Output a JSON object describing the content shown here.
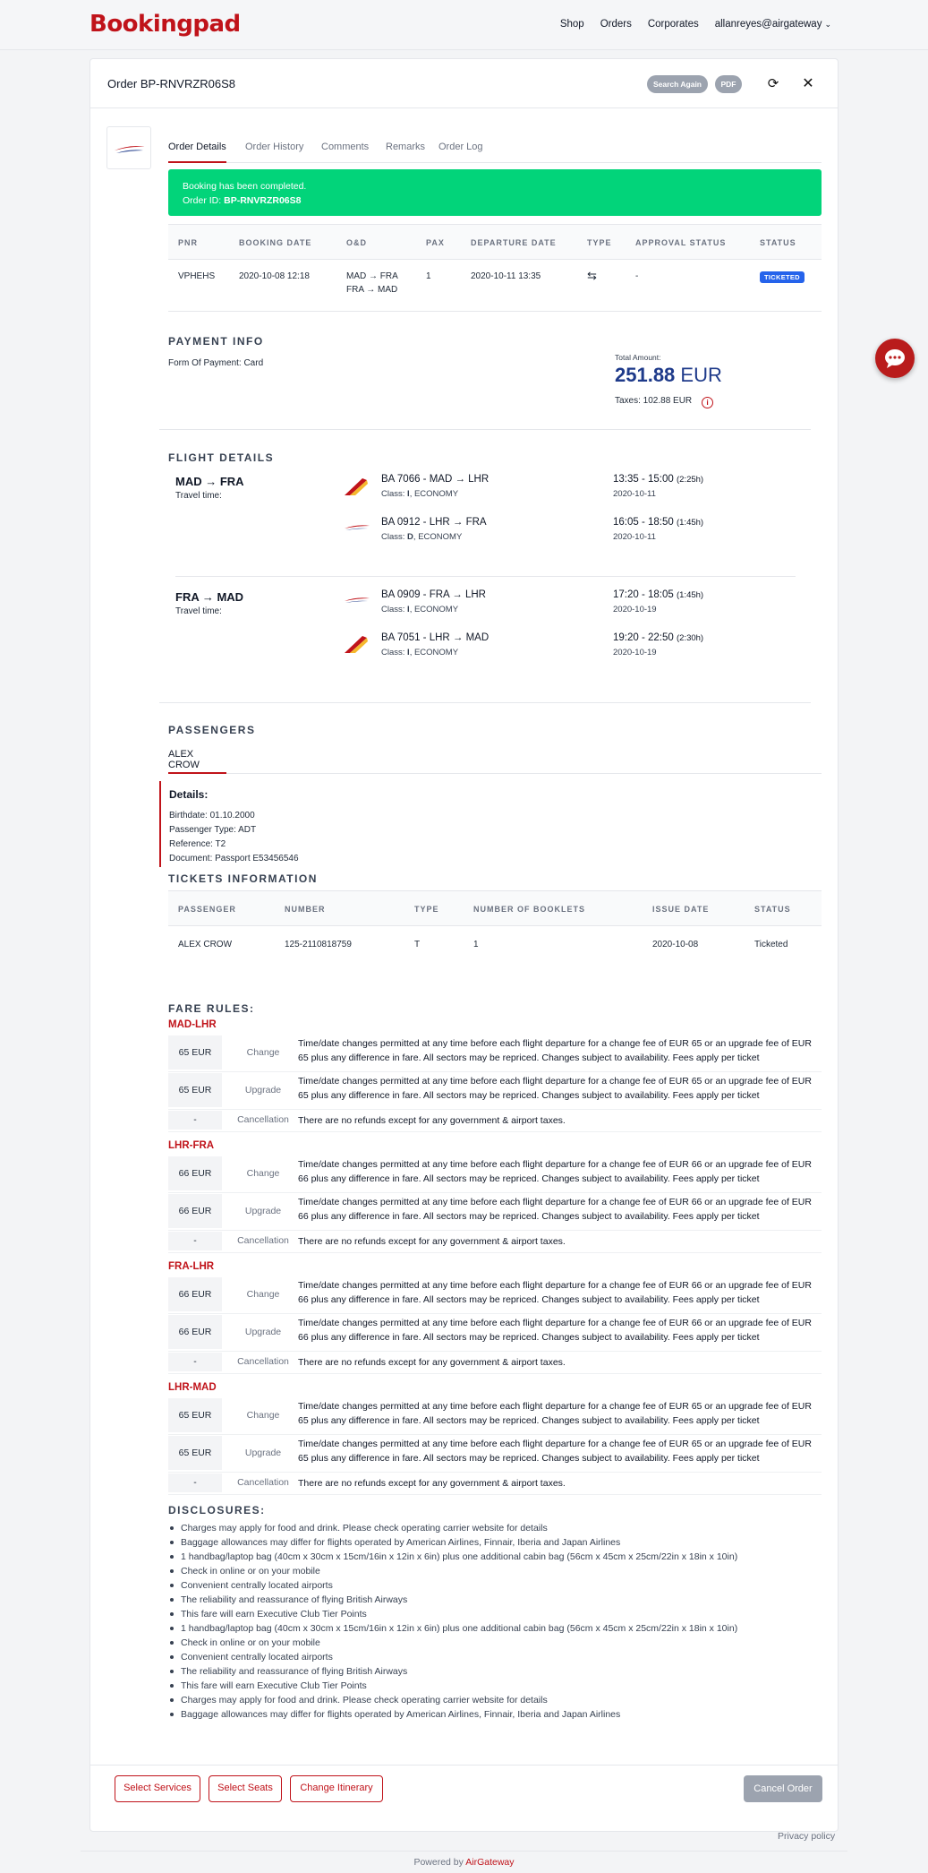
{
  "brand": {
    "name": "Bookingpad"
  },
  "nav": {
    "shop": "Shop",
    "orders": "Orders",
    "corporates": "Corporates",
    "user": "allanreyes@airgateway"
  },
  "order": {
    "title": "Order BP-RNVRZR06S8",
    "search_again": "Search Again",
    "pdf": "PDF"
  },
  "tabs": [
    "Order Details",
    "Order History",
    "Comments",
    "Remarks",
    "Order Log"
  ],
  "alert": {
    "line1": "Booking has been completed.",
    "line2_label": "Order ID:",
    "line2_value": "BP-RNVRZR06S8"
  },
  "booking_table": {
    "headers": [
      "PNR",
      "BOOKING DATE",
      "O&D",
      "PAX",
      "DEPARTURE DATE",
      "TYPE",
      "APPROVAL STATUS",
      "STATUS"
    ],
    "row": {
      "pnr": "VPHEHS",
      "booking_date": "2020-10-08 12:18",
      "od1": "MAD → FRA",
      "od2": "FRA → MAD",
      "pax": "1",
      "departure": "2020-10-11 13:35",
      "approval": "-",
      "status": "TICKETED"
    }
  },
  "payment": {
    "title": "PAYMENT INFO",
    "form": "Form Of Payment: Card",
    "total_label": "Total Amount:",
    "total_value": "251.88",
    "currency": "EUR",
    "taxes": "Taxes: 102.88 EUR"
  },
  "flights": {
    "title": "FLIGHT DETAILS",
    "travel_time_label": "Travel time:",
    "legs": [
      {
        "route": "MAD → FRA",
        "segments": [
          {
            "title": "BA 7066 - MAD → LHR",
            "class_label": "Class:",
            "class_code": "I",
            "cabin": ", ECONOMY",
            "time": "13:35 - 15:00",
            "duration": "(2:25h)",
            "date": "2020-10-11"
          },
          {
            "title": "BA 0912 - LHR → FRA",
            "class_label": "Class:",
            "class_code": "D",
            "cabin": ", ECONOMY",
            "time": "16:05 - 18:50",
            "duration": "(1:45h)",
            "date": "2020-10-11"
          }
        ]
      },
      {
        "route": "FRA → MAD",
        "segments": [
          {
            "title": "BA 0909 - FRA → LHR",
            "class_label": "Class:",
            "class_code": "I",
            "cabin": ", ECONOMY",
            "time": "17:20 - 18:05",
            "duration": "(1:45h)",
            "date": "2020-10-19"
          },
          {
            "title": "BA 7051 - LHR → MAD",
            "class_label": "Class:",
            "class_code": "I",
            "cabin": ", ECONOMY",
            "time": "19:20 - 22:50",
            "duration": "(2:30h)",
            "date": "2020-10-19"
          }
        ]
      }
    ]
  },
  "passengers": {
    "title": "PASSENGERS",
    "tab": "ALEX CROW",
    "details_title": "Details:",
    "birthdate": "Birthdate: 01.10.2000",
    "type": "Passenger Type: ADT",
    "reference": "Reference: T2",
    "document": "Document: Passport E53456546"
  },
  "tickets": {
    "title": "TICKETS INFORMATION",
    "headers": [
      "PASSENGER",
      "NUMBER",
      "TYPE",
      "NUMBER OF BOOKLETS",
      "ISSUE DATE",
      "STATUS"
    ],
    "row": {
      "passenger": "ALEX CROW",
      "number": "125-2110818759",
      "type": "T",
      "booklets": "1",
      "issue_date": "2020-10-08",
      "status": "Ticketed"
    }
  },
  "fare_rules": {
    "title": "FARE RULES:",
    "groups": [
      {
        "route": "MAD-LHR",
        "rows": [
          {
            "price": "65 EUR",
            "type": "Change",
            "text": "Time/date changes permitted at any time before each flight departure for a change fee of EUR 65 or an upgrade fee of EUR 65 plus any difference in fare. All sectors may be repriced. Changes subject to availability. Fees apply per ticket"
          },
          {
            "price": "65 EUR",
            "type": "Upgrade",
            "text": "Time/date changes permitted at any time before each flight departure for a change fee of EUR 65 or an upgrade fee of EUR 65 plus any difference in fare. All sectors may be repriced. Changes subject to availability. Fees apply per ticket"
          },
          {
            "price": "-",
            "type": "Cancellation",
            "text": "There are no refunds except for any government & airport taxes."
          }
        ]
      },
      {
        "route": "LHR-FRA",
        "rows": [
          {
            "price": "66 EUR",
            "type": "Change",
            "text": "Time/date changes permitted at any time before each flight departure for a change fee of EUR 66 or an upgrade fee of EUR 66 plus any difference in fare. All sectors may be repriced. Changes subject to availability. Fees apply per ticket"
          },
          {
            "price": "66 EUR",
            "type": "Upgrade",
            "text": "Time/date changes permitted at any time before each flight departure for a change fee of EUR 66 or an upgrade fee of EUR 66 plus any difference in fare. All sectors may be repriced. Changes subject to availability. Fees apply per ticket"
          },
          {
            "price": "-",
            "type": "Cancellation",
            "text": "There are no refunds except for any government & airport taxes."
          }
        ]
      },
      {
        "route": "FRA-LHR",
        "rows": [
          {
            "price": "66 EUR",
            "type": "Change",
            "text": "Time/date changes permitted at any time before each flight departure for a change fee of EUR 66 or an upgrade fee of EUR 66 plus any difference in fare. All sectors may be repriced. Changes subject to availability. Fees apply per ticket"
          },
          {
            "price": "66 EUR",
            "type": "Upgrade",
            "text": "Time/date changes permitted at any time before each flight departure for a change fee of EUR 66 or an upgrade fee of EUR 66 plus any difference in fare. All sectors may be repriced. Changes subject to availability. Fees apply per ticket"
          },
          {
            "price": "-",
            "type": "Cancellation",
            "text": "There are no refunds except for any government & airport taxes."
          }
        ]
      },
      {
        "route": "LHR-MAD",
        "rows": [
          {
            "price": "65 EUR",
            "type": "Change",
            "text": "Time/date changes permitted at any time before each flight departure for a change fee of EUR 65 or an upgrade fee of EUR 65 plus any difference in fare. All sectors may be repriced. Changes subject to availability. Fees apply per ticket"
          },
          {
            "price": "65 EUR",
            "type": "Upgrade",
            "text": "Time/date changes permitted at any time before each flight departure for a change fee of EUR 65 or an upgrade fee of EUR 65 plus any difference in fare. All sectors may be repriced. Changes subject to availability. Fees apply per ticket"
          },
          {
            "price": "-",
            "type": "Cancellation",
            "text": "There are no refunds except for any government & airport taxes."
          }
        ]
      }
    ]
  },
  "disclosures": {
    "title": "DISCLOSURES:",
    "items": [
      "Charges may apply for food and drink. Please check operating carrier website for details",
      "Baggage allowances may differ for flights operated by American Airlines, Finnair, Iberia and Japan Airlines",
      "1 handbag/laptop bag (40cm x 30cm x 15cm/16in x 12in x 6in) plus one additional cabin bag (56cm x 45cm x 25cm/22in x 18in x 10in)",
      "Check in online or on your mobile",
      "Convenient centrally located airports",
      "The reliability and reassurance of flying British Airways",
      "This fare will earn Executive Club Tier Points",
      "1 handbag/laptop bag (40cm x 30cm x 15cm/16in x 12in x 6in) plus one additional cabin bag (56cm x 45cm x 25cm/22in x 18in x 10in)",
      "Check in online or on your mobile",
      "Convenient centrally located airports",
      "The reliability and reassurance of flying British Airways",
      "This fare will earn Executive Club Tier Points",
      "Charges may apply for food and drink. Please check operating carrier website for details",
      "Baggage allowances may differ for flights operated by American Airlines, Finnair, Iberia and Japan Airlines"
    ]
  },
  "actions": {
    "select_services": "Select Services",
    "select_seats": "Select Seats",
    "change_itinerary": "Change Itinerary",
    "cancel_order": "Cancel Order"
  },
  "footer": {
    "privacy": "Privacy policy",
    "powered_by": "Powered by",
    "powered_brand": "AirGateway"
  },
  "colors": {
    "brand": "#c0131a",
    "success": "#02d47a",
    "badge": "#2563eb",
    "total": "#1e3a8a"
  }
}
